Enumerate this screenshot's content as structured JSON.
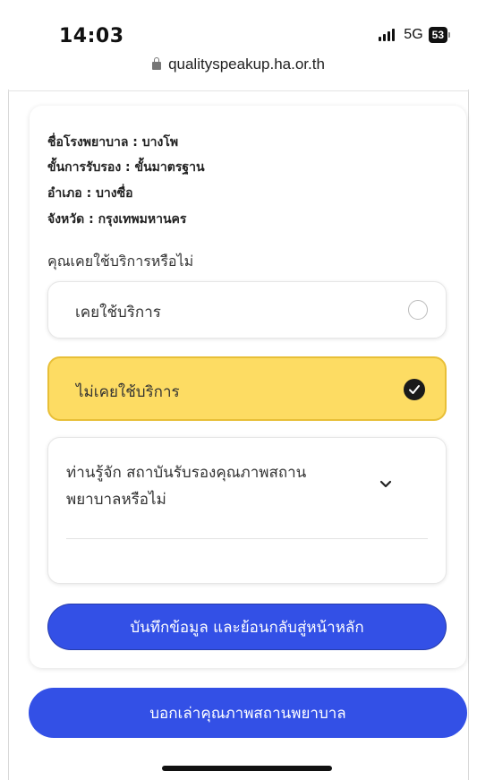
{
  "status_bar": {
    "time": "14:03",
    "network": "5G",
    "battery": "53"
  },
  "browser": {
    "url": "qualityspeakup.ha.or.th"
  },
  "hospital_info": {
    "name_line": "ชื่อโรงพยาบาล : บางโพ",
    "accreditation_line": "ขั้นการรับรอง : ขั้นมาตรฐาน",
    "district_line": "อำเภอ : บางซื่อ",
    "province_line": "จังหวัด : กรุงเทพมหานคร"
  },
  "form": {
    "question": "คุณเคยใช้บริการหรือไม่",
    "options": [
      {
        "label": "เคยใช้บริการ",
        "selected": false
      },
      {
        "label": "ไม่เคยใช้บริการ",
        "selected": true
      }
    ],
    "know_question": "ท่านรู้จัก สถาบันรับรองคุณภาพสถานพยาบาลหรือไม่",
    "save_button": "บันทึกข้อมูล และย้อนกลับสู่หน้าหลัก"
  },
  "bottom_button": "บอกเล่าคุณภาพสถานพยาบาล",
  "colors": {
    "primary": "#3350e6",
    "selected_bg": "#fddc63",
    "selected_border": "#e8bf37"
  }
}
